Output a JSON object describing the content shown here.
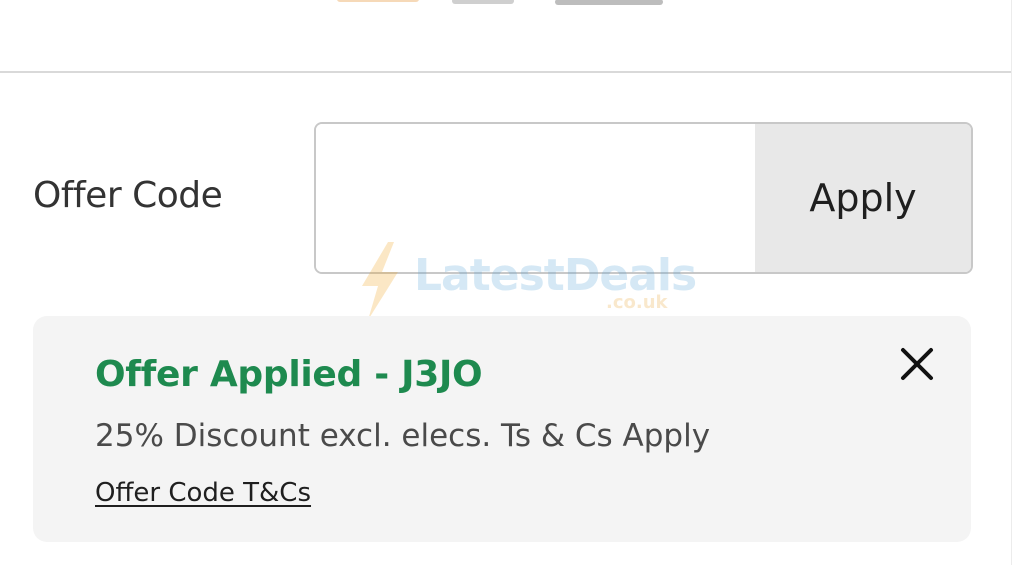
{
  "offer_code": {
    "label": "Offer Code",
    "input_value": "",
    "apply_label": "Apply"
  },
  "watermark": {
    "brand": "LatestDeals",
    "domain": ".co.uk"
  },
  "applied": {
    "title": "Offer Applied - J3JO",
    "description": "25% Discount excl. elecs. Ts & Cs Apply",
    "link_label": "Offer Code T&Cs",
    "close_icon": "close-icon"
  },
  "colors": {
    "accent_green": "#1e8a4f",
    "panel_bg": "#f4f4f4",
    "apply_bg": "#e8e8e8"
  }
}
